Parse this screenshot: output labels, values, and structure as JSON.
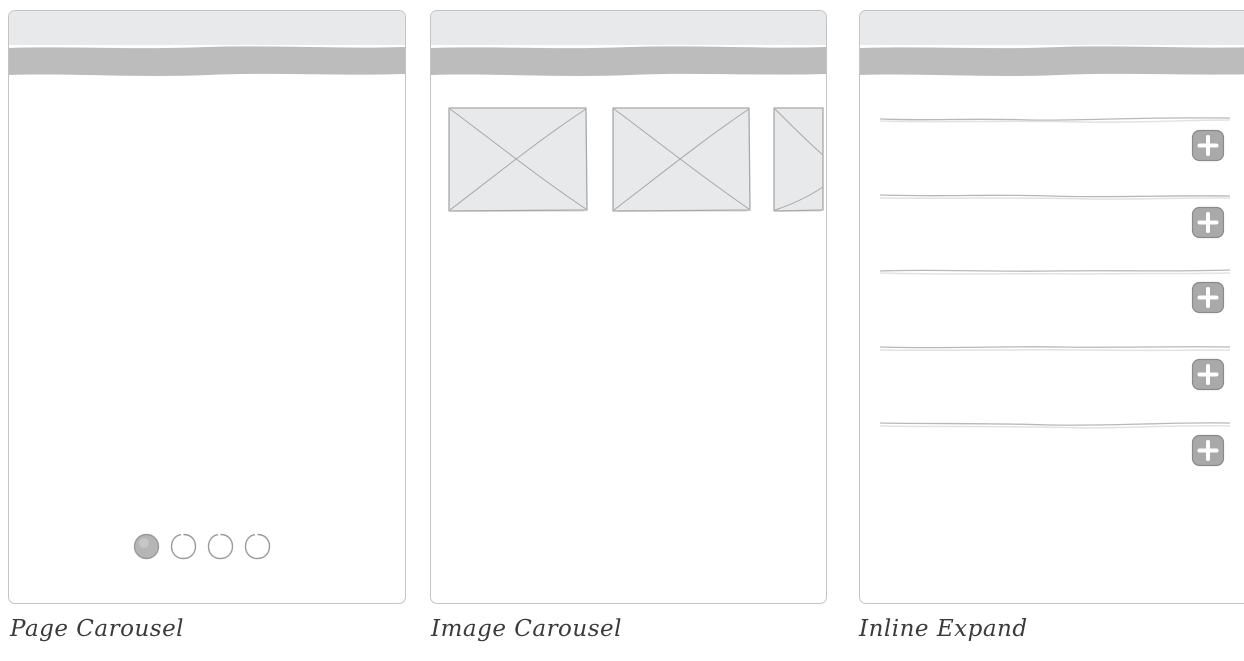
{
  "panels": [
    {
      "caption": "Page Carousel"
    },
    {
      "caption": "Image Carousel"
    },
    {
      "caption": "Inline Expand"
    }
  ],
  "page_carousel": {
    "indicator_count": 4,
    "active_index": 0
  },
  "image_carousel": {
    "thumbnails": [
      "image-placeholder-1",
      "image-placeholder-2",
      "image-placeholder-3"
    ]
  },
  "inline_expand": {
    "rows": 5,
    "button_icon": "plus-icon"
  },
  "colors": {
    "status_bar": "#e8e9ea",
    "nav_bar": "#bcbcbc",
    "frame_border": "#c4c4c4",
    "placeholder_fill": "#e8e9ea",
    "button_fill": "#a9a9a9",
    "caption_text": "#3a3a3a"
  }
}
